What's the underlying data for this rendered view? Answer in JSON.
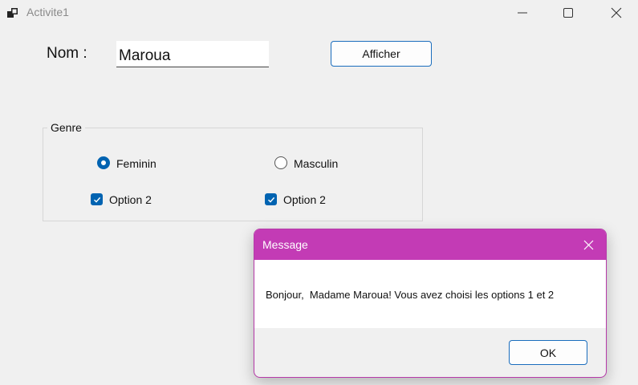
{
  "window": {
    "title": "Activite1",
    "icon": "app-window-icon",
    "controls": [
      "minimize-icon",
      "maximize-icon",
      "close-icon"
    ]
  },
  "form": {
    "nom_label": "Nom :",
    "nom_value": "Maroua",
    "afficher_label": "Afficher",
    "group": {
      "legend": "Genre",
      "radios": [
        {
          "label": "Feminin",
          "checked": true
        },
        {
          "label": "Masculin",
          "checked": false
        }
      ],
      "checkboxes": [
        {
          "label": "Option 2",
          "checked": true
        },
        {
          "label": "Option 2",
          "checked": true
        }
      ]
    }
  },
  "dialog": {
    "title": "Message",
    "message": "Bonjour,  Madame Maroua! Vous avez choisi les options 1 et 2",
    "ok_label": "OK",
    "accent_color": "#c33bb5"
  },
  "colors": {
    "window_bg": "#f0f0f0",
    "accent": "#0063b1",
    "button_border": "#1a6dbd"
  }
}
